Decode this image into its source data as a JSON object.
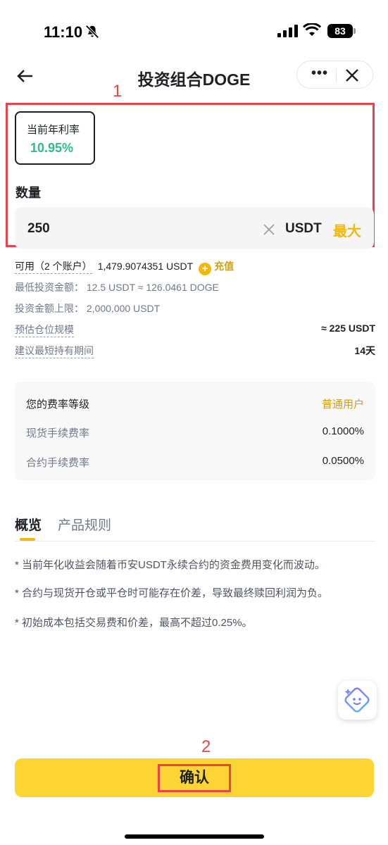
{
  "status_bar": {
    "time": "11:10",
    "battery": "83"
  },
  "header": {
    "title": "投资组合DOGE",
    "more_label": "•••"
  },
  "annotations": {
    "box1_number": "1",
    "box2_number": "2"
  },
  "apr": {
    "label": "当前年利率",
    "value": "10.95%"
  },
  "quantity": {
    "label": "数量",
    "value": "250",
    "unit": "USDT",
    "max_label": "最大"
  },
  "info": {
    "available_label": "可用（2 个账户）",
    "available_value": "1,479.9074351 USDT",
    "recharge_label": "充值",
    "min_invest": "最低投资金额：  12.5 USDT ≈ 126.0461 DOGE",
    "max_invest": "投资金额上限：  2,000,000 USDT",
    "position_label": "预估仓位规模",
    "position_value": "≈ 225 USDT",
    "hold_label": "建议最短持有期间",
    "hold_value": "14天"
  },
  "fees": {
    "tier_label": "您的费率等级",
    "tier_value": "普通用户",
    "spot_label": "现货手续费率",
    "spot_value": "0.1000%",
    "futures_label": "合约手续费率",
    "futures_value": "0.0500%"
  },
  "tabs": [
    {
      "label": "概览"
    },
    {
      "label": "产品规则"
    }
  ],
  "notes": [
    "* 当前年化收益会随着币安USDT永续合约的资金费用变化而波动。",
    "* 合约与现货开仓或平仓时可能存在价差，导致最终赎回利润为负。",
    "* 初始成本包括交易费和价差，最高不超过0.25%。"
  ],
  "confirm_label": "确认",
  "colors": {
    "accent": "#f0b90b",
    "green": "#2ebd85",
    "annotation": "#e8444a",
    "button": "#fcd535"
  }
}
